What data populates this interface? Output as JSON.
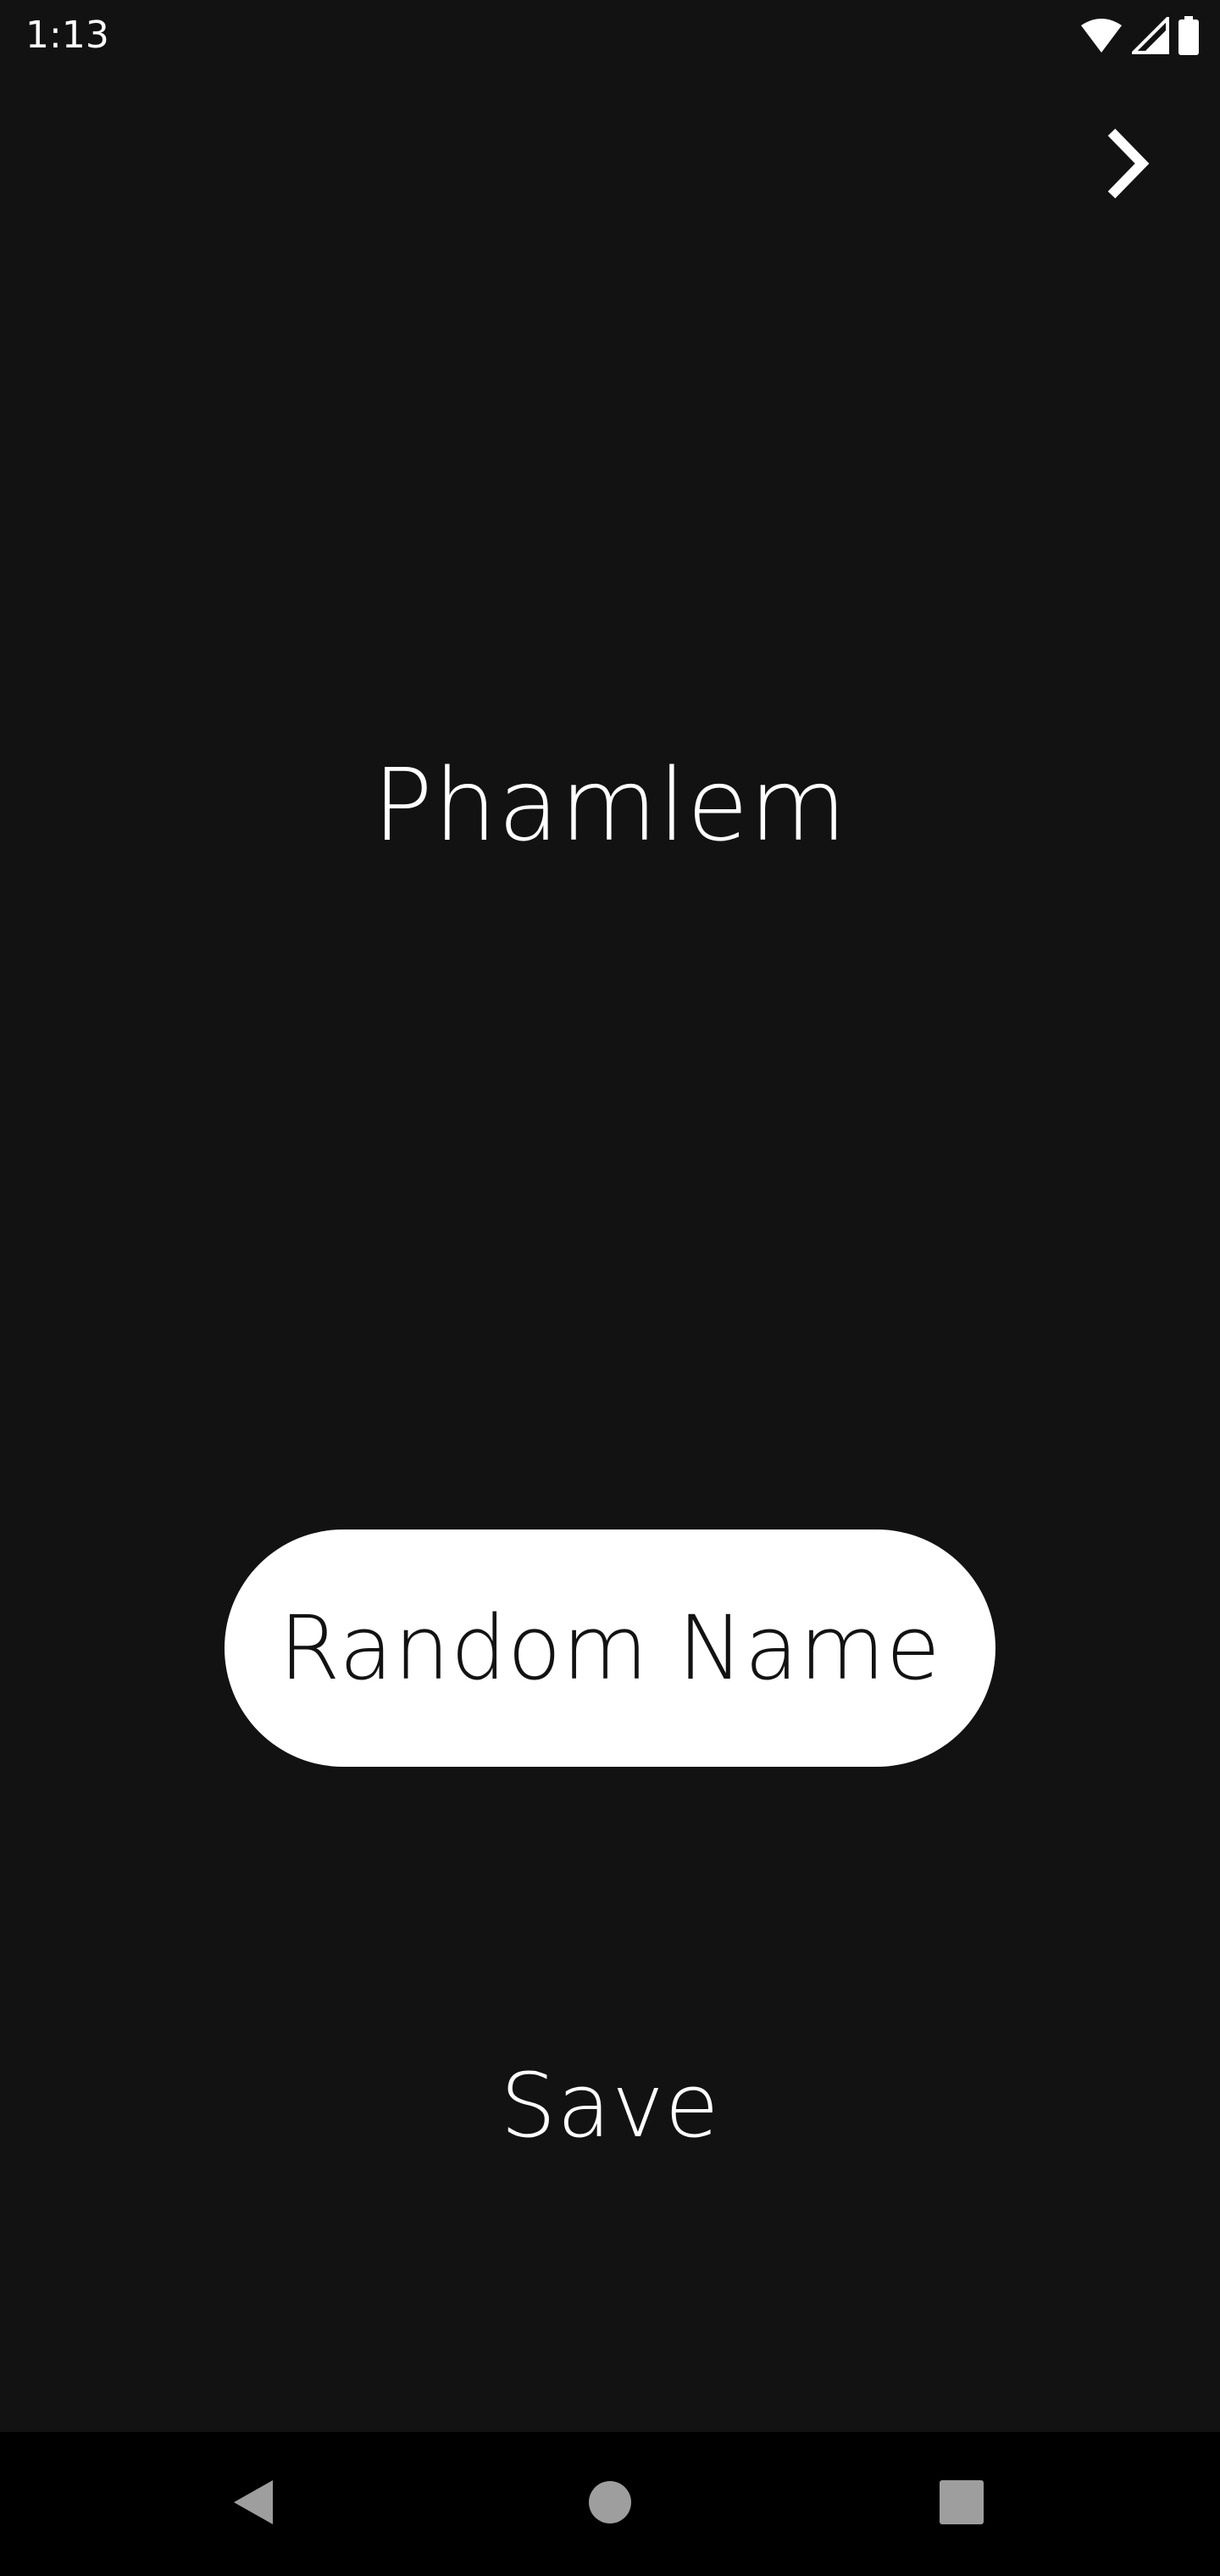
{
  "status_bar": {
    "time": "1:13",
    "icons": [
      "wifi-icon",
      "cellular-signal-icon",
      "battery-icon"
    ]
  },
  "header": {
    "next_icon": "chevron-right-icon"
  },
  "main": {
    "generated_name": "Phamlem",
    "random_button_label": "Random Name",
    "save_label": "Save"
  },
  "nav_bar": {
    "icons": [
      "back-icon",
      "home-icon",
      "recents-icon"
    ]
  },
  "colors": {
    "background": "#121212",
    "text": "#ffffff",
    "button_background": "#ffffff",
    "button_text": "#121212",
    "nav_background": "#000000",
    "nav_icon": "#9e9e9e"
  }
}
